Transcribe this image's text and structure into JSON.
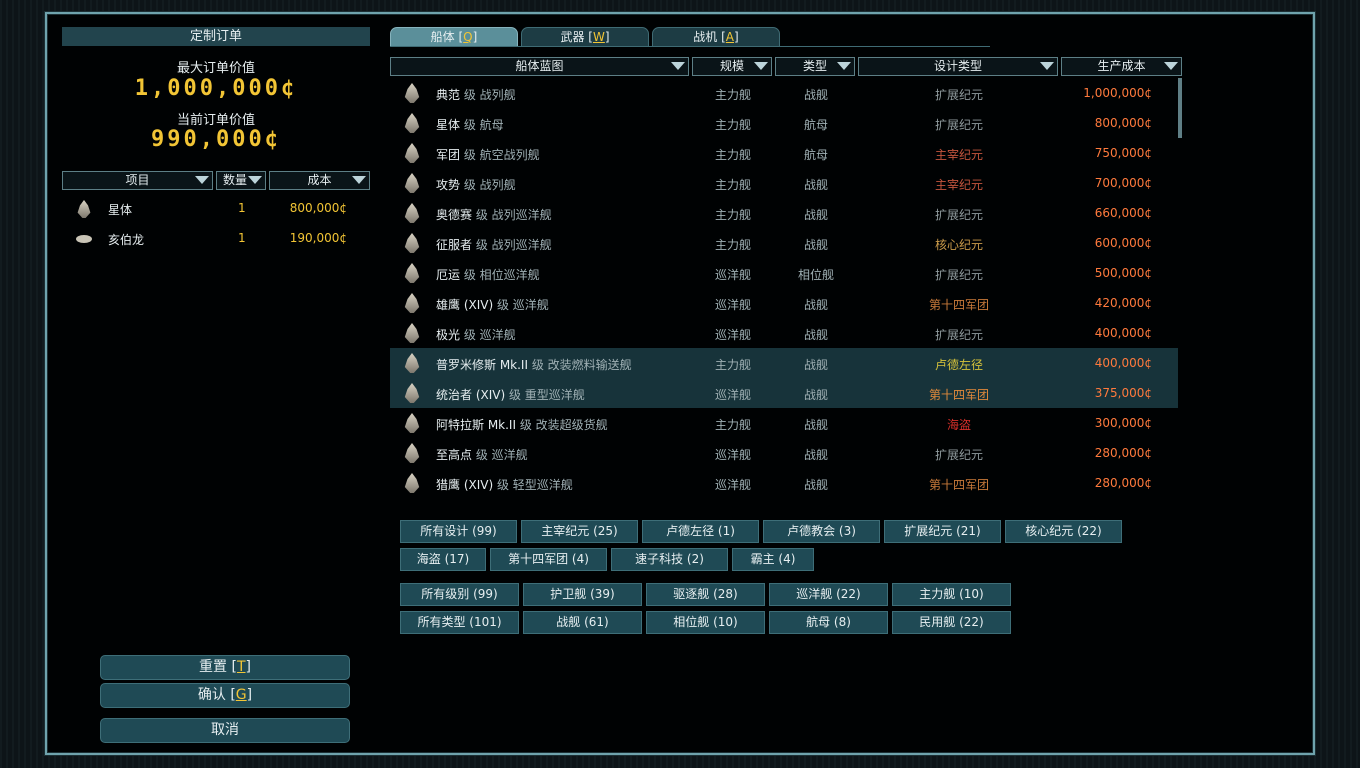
{
  "left_panel": {
    "title": "定制订单",
    "max_value_label": "最大订单价值",
    "max_value": "1,000,000¢",
    "current_value_label": "当前订单价值",
    "current_value": "990,000¢",
    "columns": [
      "项目",
      "数量",
      "成本"
    ],
    "items": [
      {
        "name": "星体",
        "qty": "1",
        "cost": "800,000¢",
        "icon": "ship-icon"
      },
      {
        "name": "亥伯龙",
        "qty": "1",
        "cost": "190,000¢",
        "icon": "fighter-icon"
      }
    ],
    "buttons": {
      "reset": "重置 [",
      "reset_key": "T",
      "confirm": "确认 [",
      "confirm_key": "G",
      "cancel": "取消"
    }
  },
  "tabs": [
    {
      "label": "船体 [",
      "key": "Q",
      "active": true
    },
    {
      "label": "武器 [",
      "key": "W",
      "active": false
    },
    {
      "label": "战机 [",
      "key": "A",
      "active": false
    }
  ],
  "table": {
    "columns": [
      "船体蓝图",
      "规模",
      "类型",
      "设计类型",
      "生产成本"
    ],
    "rows": [
      {
        "name": "典范",
        "cls": "级 战列舰",
        "size": "主力舰",
        "type": "战舰",
        "design": "扩展纪元",
        "design_color": "#8f9a9d",
        "cost": "1,000,000¢",
        "hl": false
      },
      {
        "name": "星体",
        "cls": "级 航母",
        "size": "主力舰",
        "type": "航母",
        "design": "扩展纪元",
        "design_color": "#8f9a9d",
        "cost": "800,000¢",
        "hl": false
      },
      {
        "name": "军团",
        "cls": "级 航空战列舰",
        "size": "主力舰",
        "type": "航母",
        "design": "主宰纪元",
        "design_color": "#c4553e",
        "cost": "750,000¢",
        "hl": false
      },
      {
        "name": "攻势",
        "cls": "级 战列舰",
        "size": "主力舰",
        "type": "战舰",
        "design": "主宰纪元",
        "design_color": "#c4553e",
        "cost": "700,000¢",
        "hl": false
      },
      {
        "name": "奥德赛",
        "cls": "级 战列巡洋舰",
        "size": "主力舰",
        "type": "战舰",
        "design": "扩展纪元",
        "design_color": "#8f9a9d",
        "cost": "660,000¢",
        "hl": false
      },
      {
        "name": "征服者",
        "cls": "级 战列巡洋舰",
        "size": "主力舰",
        "type": "战舰",
        "design": "核心纪元",
        "design_color": "#c99a4a",
        "cost": "600,000¢",
        "hl": false
      },
      {
        "name": "厄运",
        "cls": "级 相位巡洋舰",
        "size": "巡洋舰",
        "type": "相位舰",
        "design": "扩展纪元",
        "design_color": "#8f9a9d",
        "cost": "500,000¢",
        "hl": false
      },
      {
        "name": "雄鹰 (XIV)",
        "cls": "级 巡洋舰",
        "size": "巡洋舰",
        "type": "战舰",
        "design": "第十四军团",
        "design_color": "#c97a3a",
        "cost": "420,000¢",
        "hl": false
      },
      {
        "name": "极光",
        "cls": "级 巡洋舰",
        "size": "巡洋舰",
        "type": "战舰",
        "design": "扩展纪元",
        "design_color": "#8f9a9d",
        "cost": "400,000¢",
        "hl": false
      },
      {
        "name": "普罗米修斯 Mk.II",
        "cls": "级 改装燃料输送舰",
        "size": "主力舰",
        "type": "战舰",
        "design": "卢德左径",
        "design_color": "#d6c23a",
        "cost": "400,000¢",
        "hl": true
      },
      {
        "name": "统治者 (XIV)",
        "cls": "级 重型巡洋舰",
        "size": "巡洋舰",
        "type": "战舰",
        "design": "第十四军团",
        "design_color": "#e0893a",
        "cost": "375,000¢",
        "hl": true
      },
      {
        "name": "阿特拉斯 Mk.II",
        "cls": "级 改装超级货舰",
        "size": "主力舰",
        "type": "战舰",
        "design": "海盗",
        "design_color": "#d6302a",
        "cost": "300,000¢",
        "hl": false
      },
      {
        "name": "至高点",
        "cls": "级 巡洋舰",
        "size": "巡洋舰",
        "type": "战舰",
        "design": "扩展纪元",
        "design_color": "#8f9a9d",
        "cost": "280,000¢",
        "hl": false
      },
      {
        "name": "猎鹰 (XIV)",
        "cls": "级 轻型巡洋舰",
        "size": "巡洋舰",
        "type": "战舰",
        "design": "第十四军团",
        "design_color": "#c97a3a",
        "cost": "280,000¢",
        "hl": false
      }
    ]
  },
  "filters": {
    "design": [
      "所有设计 (99)",
      "主宰纪元 (25)",
      "卢德左径 (1)",
      "卢德教会 (3)",
      "扩展纪元 (21)",
      "核心纪元 (22)",
      "海盗 (17)",
      "第十四军团 (4)",
      "速子科技 (2)",
      "霸主 (4)"
    ],
    "size": [
      "所有级别 (99)",
      "护卫舰 (39)",
      "驱逐舰 (28)",
      "巡洋舰 (22)",
      "主力舰 (10)"
    ],
    "type": [
      "所有类型 (101)",
      "战舰 (61)",
      "相位舰 (10)",
      "航母 (8)",
      "民用舰 (22)"
    ]
  },
  "colors": {
    "accent_gold": "#f2c535",
    "cost_orange": "#ff7a3d",
    "panel_teal": "#1f4a55"
  }
}
